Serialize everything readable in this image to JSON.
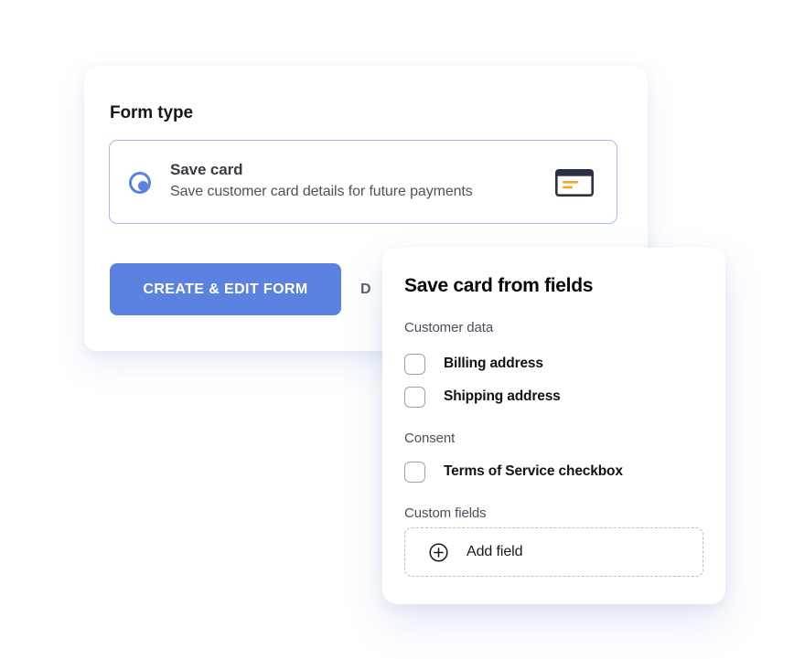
{
  "form_card": {
    "section_title": "Form type",
    "option": {
      "title": "Save card",
      "description": "Save customer card details for future payments",
      "selected": true,
      "icon": "credit-card-icon"
    },
    "actions": {
      "primary_label": "CREATE & EDIT FORM",
      "secondary_label": "D"
    }
  },
  "fields_panel": {
    "title": "Save card from fields",
    "groups": [
      {
        "label": "Customer data",
        "items": [
          {
            "label": "Billing address",
            "checked": false
          },
          {
            "label": "Shipping address",
            "checked": false
          }
        ]
      },
      {
        "label": "Consent",
        "items": [
          {
            "label": "Terms of Service checkbox",
            "checked": false
          }
        ]
      },
      {
        "label": "Custom fields",
        "items": []
      }
    ],
    "add_field": {
      "label": "Add field",
      "icon": "plus-circle-icon"
    }
  },
  "colors": {
    "accent_blue": "#5b82e0",
    "option_border": "#a6bcf0",
    "card_icon_outline": "#2d3142",
    "card_icon_stripe": "#f5a623",
    "checkbox_border": "#9ba1ab",
    "dashed_border": "#b9bcc3",
    "page_background": "#ffffff"
  }
}
